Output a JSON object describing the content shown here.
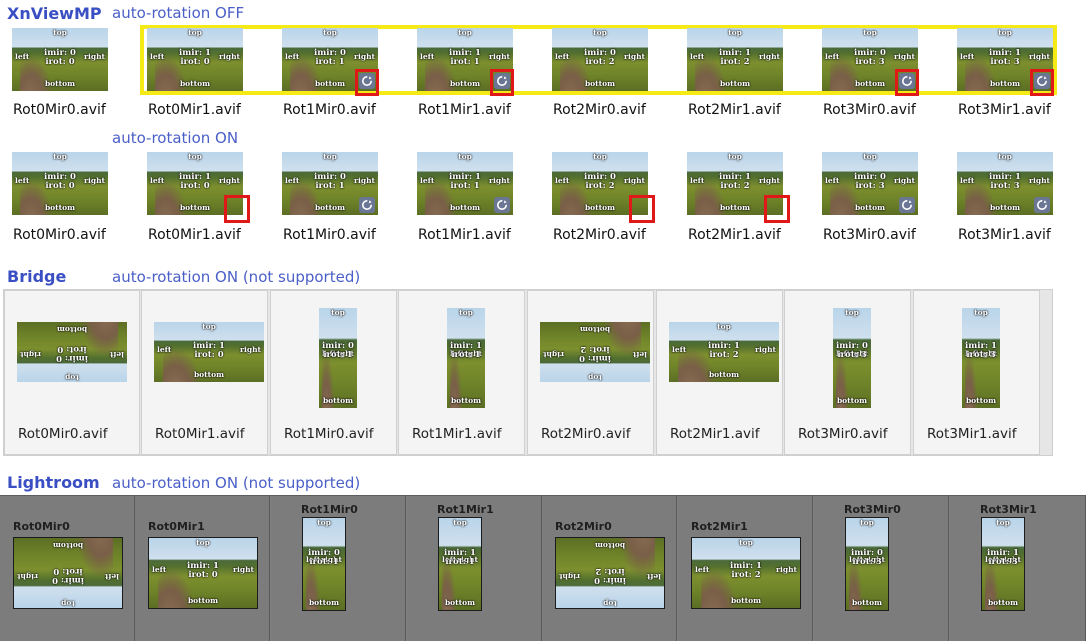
{
  "sections": {
    "xnview_title": "XnViewMP",
    "xnview_off_note": "auto-rotation OFF",
    "xnview_on_note": "auto-rotation ON",
    "bridge_title": "Bridge",
    "bridge_note": "auto-rotation ON (not supported)",
    "lightroom_title": "Lightroom",
    "lightroom_note": "auto-rotation ON (not supported)"
  },
  "photo_labels": {
    "top": "top",
    "left": "left",
    "right": "right",
    "bottom": "bottom"
  },
  "files": [
    "Rot0Mir0.avif",
    "Rot0Mir1.avif",
    "Rot1Mir0.avif",
    "Rot1Mir1.avif",
    "Rot2Mir0.avif",
    "Rot2Mir1.avif",
    "Rot3Mir0.avif",
    "Rot3Mir1.avif"
  ],
  "thumb_text": [
    {
      "imir": "imir: 0",
      "irot": "irot: 0"
    },
    {
      "imir": "imir: 1",
      "irot": "irot: 0"
    },
    {
      "imir": "imir: 0",
      "irot": "irot: 1"
    },
    {
      "imir": "imir: 1",
      "irot": "irot: 1"
    },
    {
      "imir": "imir: 0",
      "irot": "irot: 2"
    },
    {
      "imir": "imir: 1",
      "irot": "irot: 2"
    },
    {
      "imir": "imir: 0",
      "irot": "irot: 3"
    },
    {
      "imir": "imir: 1",
      "irot": "irot: 3"
    }
  ],
  "lightroom_names": [
    "Rot0Mir0",
    "Rot0Mir1",
    "Rot1Mir0",
    "Rot1Mir1",
    "Rot2Mir0",
    "Rot2Mir1",
    "Rot3Mir0",
    "Rot3Mir1"
  ],
  "colors": {
    "title": "#3b4fc4",
    "highlight_yellow": "#f6ea16",
    "highlight_red": "#e01818",
    "rotation_badge": "#6b7694"
  },
  "icons": {
    "rotation_badge": "rotate-icon"
  }
}
